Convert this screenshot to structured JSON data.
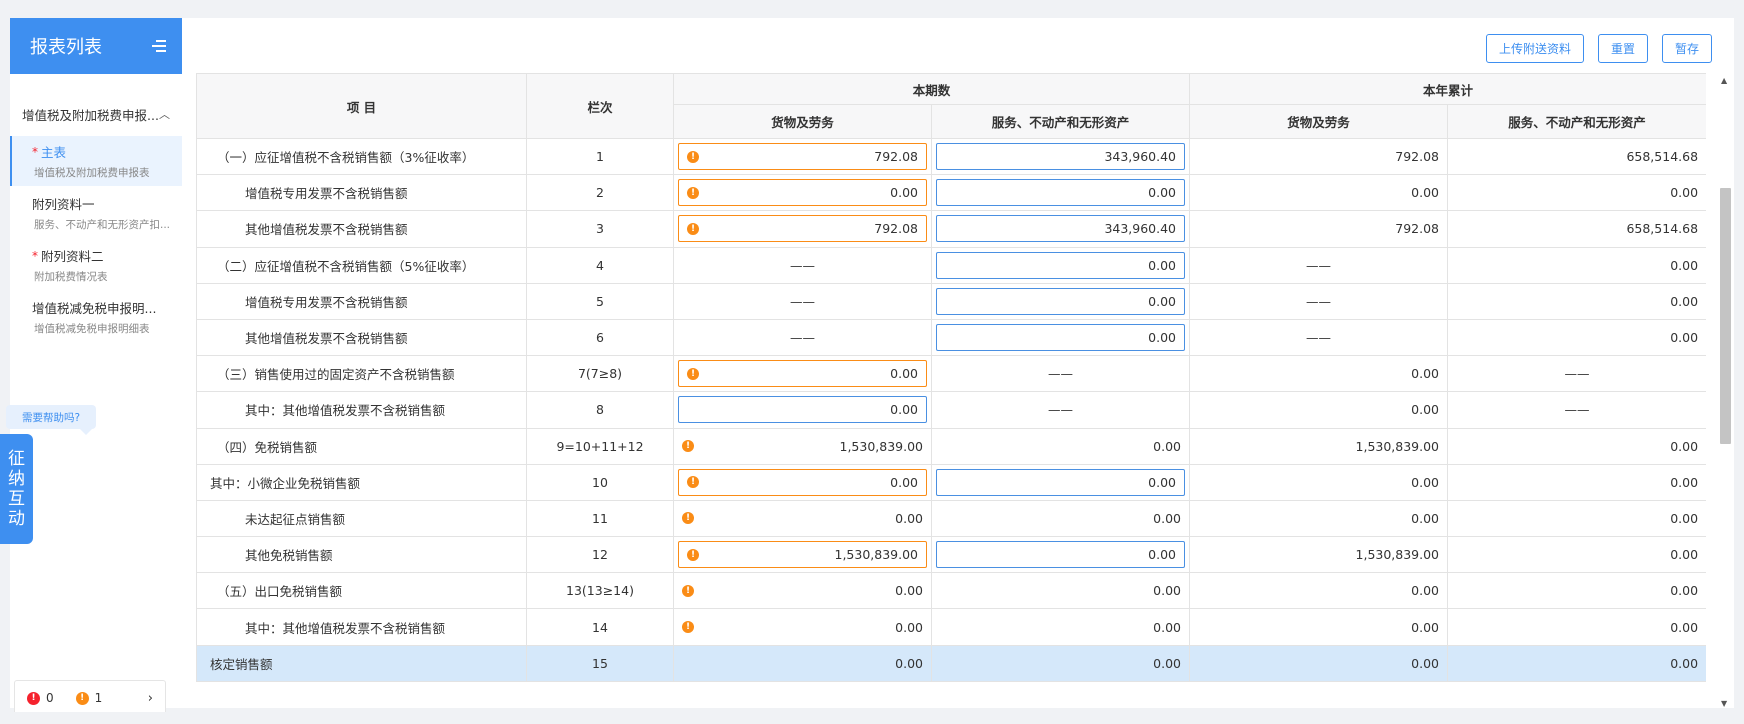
{
  "sidebar": {
    "title": "报表列表",
    "group": "增值税及附加税费申报...",
    "items": [
      {
        "title": "主表",
        "sub": "增值税及附加税费申报表",
        "required": true,
        "active": true
      },
      {
        "title": "附列资料一",
        "sub": "服务、不动产和无形资产扣...",
        "required": false,
        "active": false
      },
      {
        "title": "附列资料二",
        "sub": "附加税费情况表",
        "required": true,
        "active": false
      },
      {
        "title": "增值税减免税申报明...",
        "sub": "增值税减免税申报明细表",
        "required": false,
        "active": false
      }
    ],
    "help_text": "需要帮助吗?",
    "interact_chars": [
      "征",
      "纳",
      "互",
      "动"
    ]
  },
  "status": {
    "errors": "0",
    "warnings": "1"
  },
  "toolbar": {
    "upload": "上传附送资料",
    "reset": "重置",
    "save": "暂存"
  },
  "table": {
    "headers": {
      "item": "项 目",
      "col": "栏次",
      "current": "本期数",
      "ytd": "本年累计",
      "goods": "货物及劳务",
      "services": "服务、不动产和无形资产"
    },
    "rows": [
      {
        "item": "（一）应征增值税不含税销售额（3%征收率）",
        "col": "1",
        "a": "792.08",
        "b": "343,960.40",
        "c": "792.08",
        "d": "658,514.68"
      },
      {
        "item": "增值税专用发票不含税销售额",
        "col": "2",
        "a": "0.00",
        "b": "0.00",
        "c": "0.00",
        "d": "0.00"
      },
      {
        "item": "其他增值税发票不含税销售额",
        "col": "3",
        "a": "792.08",
        "b": "343,960.40",
        "c": "792.08",
        "d": "658,514.68"
      },
      {
        "item": "（二）应征增值税不含税销售额（5%征收率）",
        "col": "4",
        "a": "——",
        "b": "0.00",
        "c": "——",
        "d": "0.00"
      },
      {
        "item": "增值税专用发票不含税销售额",
        "col": "5",
        "a": "——",
        "b": "0.00",
        "c": "——",
        "d": "0.00"
      },
      {
        "item": "其他增值税发票不含税销售额",
        "col": "6",
        "a": "——",
        "b": "0.00",
        "c": "——",
        "d": "0.00"
      },
      {
        "item": "（三）销售使用过的固定资产不含税销售额",
        "col": "7(7≥8)",
        "a": "0.00",
        "b": "——",
        "c": "0.00",
        "d": "——"
      },
      {
        "item": "其中：其他增值税发票不含税销售额",
        "col": "8",
        "a": "0.00",
        "b": "——",
        "c": "0.00",
        "d": "——"
      },
      {
        "item": "（四）免税销售额",
        "col": "9=10+11+12",
        "a": "1,530,839.00",
        "b": "0.00",
        "c": "1,530,839.00",
        "d": "0.00"
      },
      {
        "item": "其中：小微企业免税销售额",
        "col": "10",
        "a": "0.00",
        "b": "0.00",
        "c": "0.00",
        "d": "0.00"
      },
      {
        "item": "未达起征点销售额",
        "col": "11",
        "a": "0.00",
        "b": "0.00",
        "c": "0.00",
        "d": "0.00"
      },
      {
        "item": "其他免税销售额",
        "col": "12",
        "a": "1,530,839.00",
        "b": "0.00",
        "c": "1,530,839.00",
        "d": "0.00"
      },
      {
        "item": "（五）出口免税销售额",
        "col": "13(13≥14)",
        "a": "0.00",
        "b": "0.00",
        "c": "0.00",
        "d": "0.00"
      },
      {
        "item": "其中：其他增值税发票不含税销售额",
        "col": "14",
        "a": "0.00",
        "b": "0.00",
        "c": "0.00",
        "d": "0.00"
      },
      {
        "item": "核定销售额",
        "col": "15",
        "a": "0.00",
        "b": "0.00",
        "c": "0.00",
        "d": "0.00"
      }
    ]
  },
  "colors": {
    "accent": "#3e8ff0",
    "warning": "#fa8c16",
    "error": "#f5222d",
    "highlight_row": "#d5e8fa"
  }
}
